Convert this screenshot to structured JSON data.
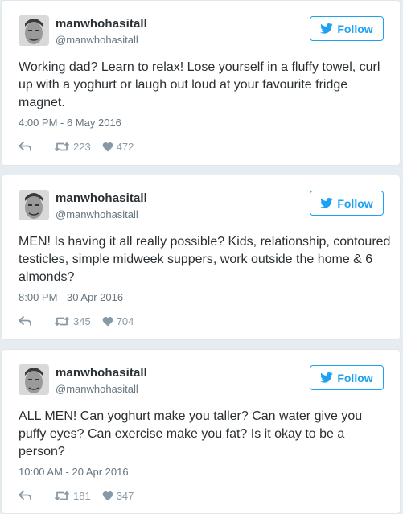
{
  "tweets": [
    {
      "name": "manwhohasitall",
      "handle": "@manwhohasitall",
      "follow_label": "Follow",
      "text": "Working dad? Learn to relax! Lose yourself in a fluffy towel, curl up with a yoghurt or laugh out loud at your favourite fridge magnet.",
      "timestamp": "4:00 PM - 6 May 2016",
      "retweets": "223",
      "likes": "472"
    },
    {
      "name": "manwhohasitall",
      "handle": "@manwhohasitall",
      "follow_label": "Follow",
      "text": "MEN! Is having it all really possible? Kids, relationship, contoured testicles, simple midweek suppers, work outside the home & 6 almonds?",
      "timestamp": "8:00 PM - 30 Apr 2016",
      "retweets": "345",
      "likes": "704"
    },
    {
      "name": "manwhohasitall",
      "handle": "@manwhohasitall",
      "follow_label": "Follow",
      "text": "ALL MEN! Can yoghurt make you taller? Can water give you puffy eyes? Can exercise make you fat? Is it okay to be a person?",
      "timestamp": "10:00 AM - 20 Apr 2016",
      "retweets": "181",
      "likes": "347"
    }
  ],
  "icons": {
    "follow": "twitter-bird-icon",
    "reply": "reply-arrow-icon",
    "retweet": "retweet-icon",
    "like": "heart-icon"
  },
  "colors": {
    "accent": "#1da1f2",
    "secondary_text": "#66757f",
    "action_gray": "#8899a6"
  }
}
